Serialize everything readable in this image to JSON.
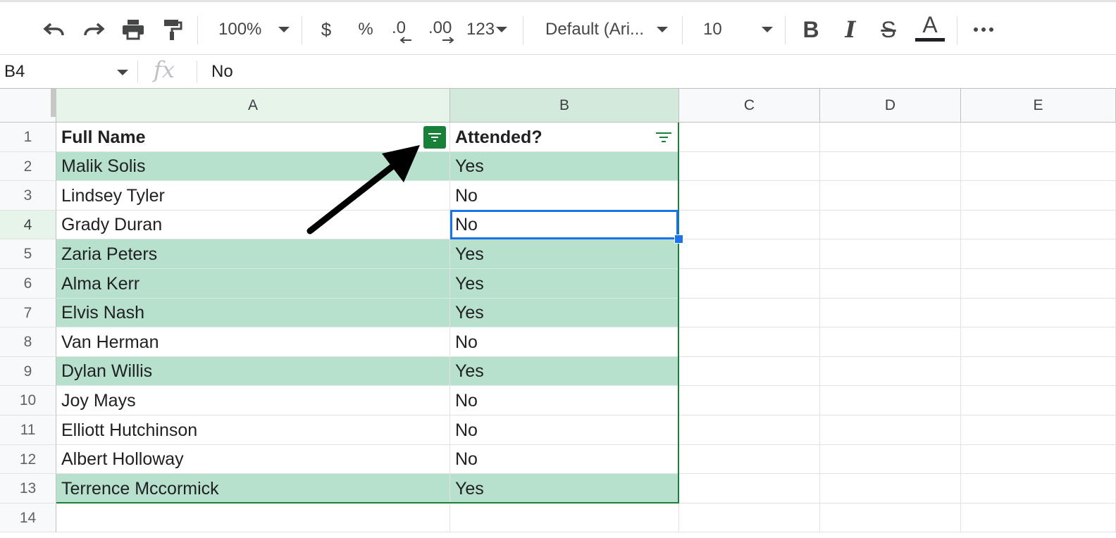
{
  "toolbar": {
    "zoom": "100%",
    "currency_label": "$",
    "percent_label": "%",
    "decrease_decimal_label": ".0",
    "increase_decimal_label": ".00",
    "format_label": "123",
    "font_family": "Default (Ari...",
    "font_size": "10",
    "icons": [
      "undo-icon",
      "redo-icon",
      "print-icon",
      "paint-format-icon",
      "bold-icon",
      "italic-icon",
      "strikethrough-icon",
      "text-color-icon",
      "more-icon"
    ]
  },
  "formula_bar": {
    "name_box": "B4",
    "fx_label": "fx",
    "value": "No"
  },
  "columns": [
    "A",
    "B",
    "C",
    "D",
    "E"
  ],
  "rows": [
    {
      "num": "1",
      "a": "Full Name",
      "b": "Attended?"
    },
    {
      "num": "2",
      "a": "Malik Solis",
      "b": "Yes"
    },
    {
      "num": "3",
      "a": "Lindsey Tyler",
      "b": "No"
    },
    {
      "num": "4",
      "a": "Grady Duran",
      "b": "No"
    },
    {
      "num": "5",
      "a": "Zaria Peters",
      "b": "Yes"
    },
    {
      "num": "6",
      "a": "Alma Kerr",
      "b": "Yes"
    },
    {
      "num": "7",
      "a": "Elvis Nash",
      "b": "Yes"
    },
    {
      "num": "8",
      "a": "Van Herman",
      "b": "No"
    },
    {
      "num": "9",
      "a": "Dylan Willis",
      "b": "Yes"
    },
    {
      "num": "10",
      "a": "Joy Mays",
      "b": "No"
    },
    {
      "num": "11",
      "a": "Elliott Hutchinson",
      "b": "No"
    },
    {
      "num": "12",
      "a": "Albert Holloway",
      "b": "No"
    },
    {
      "num": "13",
      "a": "Terrence Mccormick",
      "b": "Yes"
    },
    {
      "num": "14",
      "a": "",
      "b": ""
    }
  ],
  "colors": {
    "highlight_green": "#b7e1cd",
    "filter_green": "#188038",
    "selection_blue": "#1a73e8"
  }
}
